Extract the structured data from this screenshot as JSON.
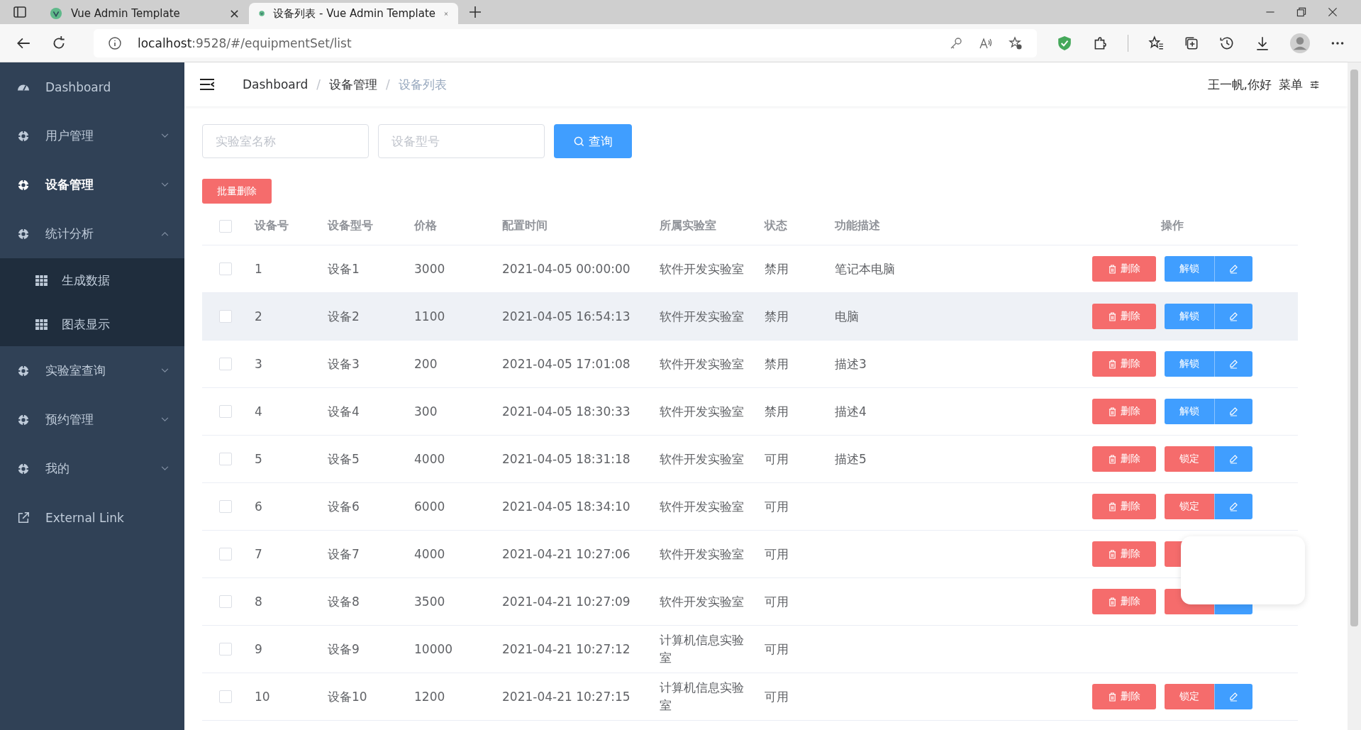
{
  "browser": {
    "tabs": [
      {
        "title": "Vue Admin Template",
        "selected": false
      },
      {
        "title": "设备列表 - Vue Admin Template",
        "selected": true
      }
    ],
    "url_host": "localhost",
    "url_path": ":9528/#/equipmentSet/list"
  },
  "sidebar": {
    "items": [
      {
        "label": "Dashboard",
        "kind": "dashboard",
        "selected": false
      },
      {
        "label": "用户管理",
        "kind": "group",
        "selected": false,
        "expanded": false
      },
      {
        "label": "设备管理",
        "kind": "group",
        "selected": true,
        "expanded": false
      },
      {
        "label": "统计分析",
        "kind": "group",
        "selected": false,
        "expanded": true,
        "children": [
          {
            "label": "生成数据"
          },
          {
            "label": "图表显示"
          }
        ]
      },
      {
        "label": "实验室查询",
        "kind": "group",
        "selected": false,
        "expanded": false
      },
      {
        "label": "预约管理",
        "kind": "group",
        "selected": false,
        "expanded": false
      },
      {
        "label": "我的",
        "kind": "group",
        "selected": false,
        "expanded": false
      },
      {
        "label": "External Link",
        "kind": "link",
        "selected": false
      }
    ]
  },
  "breadcrumb": {
    "separator": "/",
    "items": [
      "Dashboard",
      "设备管理",
      "设备列表"
    ]
  },
  "user": {
    "greeting": "王一帆,你好",
    "menu": "菜单"
  },
  "filters": {
    "lab_placeholder": "实验室名称",
    "model_placeholder": "设备型号",
    "search_button": "查询"
  },
  "batch_delete": "批量删除",
  "table": {
    "select_all_checked": false,
    "columns": [
      "设备号",
      "设备型号",
      "价格",
      "配置时间",
      "所属实验室",
      "状态",
      "功能描述",
      "操作"
    ],
    "rows": [
      {
        "checked": false,
        "id": "1",
        "model": "设备1",
        "price": "3000",
        "time": "2021-04-05 00:00:00",
        "lab": "软件开发实验室",
        "status": "禁用",
        "desc": "笔记本电脑",
        "highlighted": false,
        "color": "#409eff",
        "kind": "full",
        "delete_label": "删除",
        "lock_label": "解锁"
      },
      {
        "checked": false,
        "id": "2",
        "model": "设备2",
        "price": "1100",
        "time": "2021-04-05 16:54:13",
        "lab": "软件开发实验室",
        "status": "禁用",
        "desc": "电脑",
        "highlighted": true,
        "color": "#409eff",
        "kind": "full",
        "delete_label": "删除",
        "lock_label": "解锁"
      },
      {
        "checked": false,
        "id": "3",
        "model": "设备3",
        "price": "200",
        "time": "2021-04-05 17:01:08",
        "lab": "软件开发实验室",
        "status": "禁用",
        "desc": "描述3",
        "highlighted": false,
        "color": "#409eff",
        "kind": "full",
        "delete_label": "删除",
        "lock_label": "解锁"
      },
      {
        "checked": false,
        "id": "4",
        "model": "设备4",
        "price": "300",
        "time": "2021-04-05 18:30:33",
        "lab": "软件开发实验室",
        "status": "禁用",
        "desc": "描述4",
        "highlighted": false,
        "color": "#409eff",
        "kind": "full",
        "delete_label": "删除",
        "lock_label": "解锁"
      },
      {
        "checked": false,
        "id": "5",
        "model": "设备5",
        "price": "4000",
        "time": "2021-04-05 18:31:18",
        "lab": "软件开发实验室",
        "status": "可用",
        "desc": "描述5",
        "highlighted": false,
        "color": "#f56c6c",
        "kind": "full",
        "delete_label": "删除",
        "lock_label": "锁定"
      },
      {
        "checked": false,
        "id": "6",
        "model": "设备6",
        "price": "6000",
        "time": "2021-04-05 18:34:10",
        "lab": "软件开发实验室",
        "status": "可用",
        "highlighted": false,
        "color": "#f56c6c",
        "kind": "full",
        "delete_label": "删除",
        "lock_label": "锁定"
      },
      {
        "checked": false,
        "id": "7",
        "model": "设备7",
        "price": "4000",
        "time": "2021-04-21 10:27:06",
        "lab": "软件开发实验室",
        "status": "可用",
        "highlighted": false,
        "color": "#f56c6c",
        "kind": "covered_top",
        "delete_label": "删除"
      },
      {
        "checked": false,
        "id": "8",
        "model": "设备8",
        "price": "3500",
        "time": "2021-04-21 10:27:09",
        "lab": "软件开发实验室",
        "status": "可用",
        "highlighted": false,
        "color": "#f56c6c",
        "kind": "covered",
        "delete_label": "删除"
      },
      {
        "checked": false,
        "id": "9",
        "model": "设备9",
        "price": "10000",
        "time": "2021-04-21 10:27:12",
        "lab": "计算机信息实验室",
        "status": "可用",
        "highlighted": false,
        "kind": "none"
      },
      {
        "checked": false,
        "id": "10",
        "model": "设备10",
        "price": "1200",
        "time": "2021-04-21 10:27:15",
        "lab": "计算机信息实验室",
        "status": "可用",
        "highlighted": false,
        "color": "#f56c6c",
        "kind": "full",
        "delete_label": "删除",
        "lock_label": "锁定"
      }
    ]
  }
}
